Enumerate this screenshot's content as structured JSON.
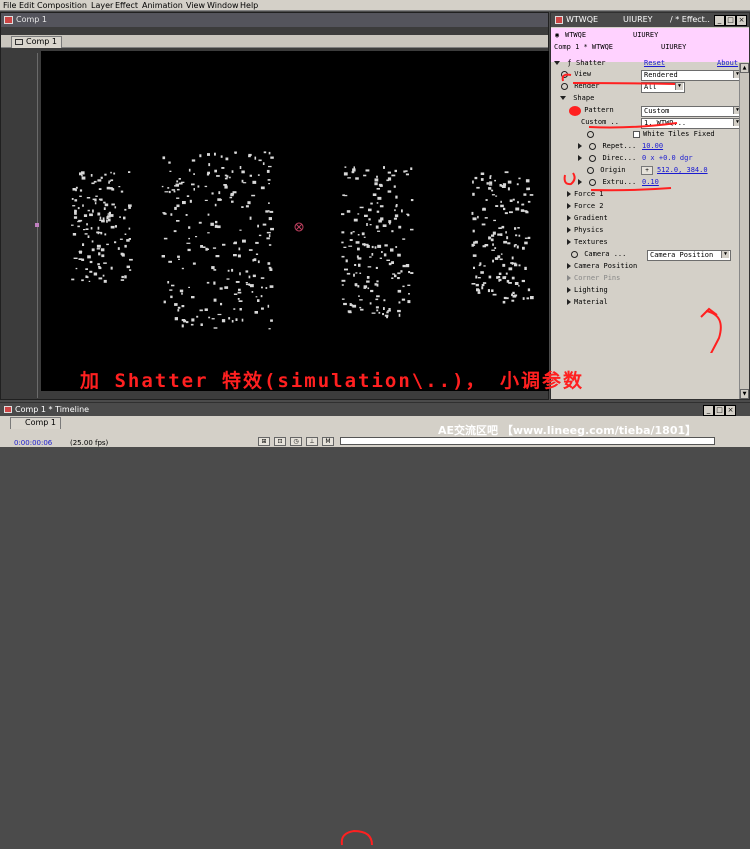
{
  "menu": [
    "File",
    "Edit",
    "Composition",
    "Layer",
    "Effect",
    "Animation",
    "View",
    "Window",
    "Help"
  ],
  "comp_window": {
    "title": "Comp 1",
    "tab": "Comp 1"
  },
  "effect_window": {
    "title_left": "WTWQE",
    "title_mid": "UIUREY",
    "title_right": "/ * Effect..",
    "header_tab_left": "WTWQE",
    "header_tab_right": "UIUREY",
    "header_row2_left": "Comp 1 * WTWQE",
    "header_row2_right": "UIUREY",
    "shatter": {
      "label": "Shatter",
      "reset": "Reset",
      "about": "About"
    },
    "view": {
      "label": "View",
      "value": "Rendered"
    },
    "render": {
      "label": "Render",
      "value": "All"
    },
    "shape": {
      "label": "Shape"
    },
    "pattern": {
      "label": "Pattern",
      "value": "Custom"
    },
    "custom": {
      "label": "Custom ..",
      "value": "1. WTWQ..."
    },
    "white_tiles": {
      "label": "White Tiles Fixed"
    },
    "repetitions": {
      "label": "Repet...",
      "value": "10.00"
    },
    "direction": {
      "label": "Direc...",
      "value": "0 x +0.0 dgr"
    },
    "origin": {
      "label": "Origin",
      "value": "512.0, 384.0"
    },
    "extrusion": {
      "label": "Extru...",
      "value": "0.10"
    },
    "groups": [
      "Force 1",
      "Force 2",
      "Gradient",
      "Physics",
      "Textures"
    ],
    "camera": {
      "label": "Camera ...",
      "value": "Camera Position"
    },
    "groups2": [
      "Camera Position",
      "Corner Pins",
      "Lighting",
      "Material"
    ]
  },
  "timeline": {
    "title": "Comp 1 * Timeline",
    "tab": "Comp 1",
    "timecode": "0:00:00:06",
    "fps": "(25.00 fps)"
  },
  "caption": "加 Shatter 特效(simulation\\..)， 小调参数",
  "watermark": "AE交流区吧 【www.lineeg.com/tieba/1801】",
  "colors": {
    "annotation_red": "#ff2020",
    "value_blue": "#1a1ad0",
    "header_pink": "#ffd2ff"
  }
}
